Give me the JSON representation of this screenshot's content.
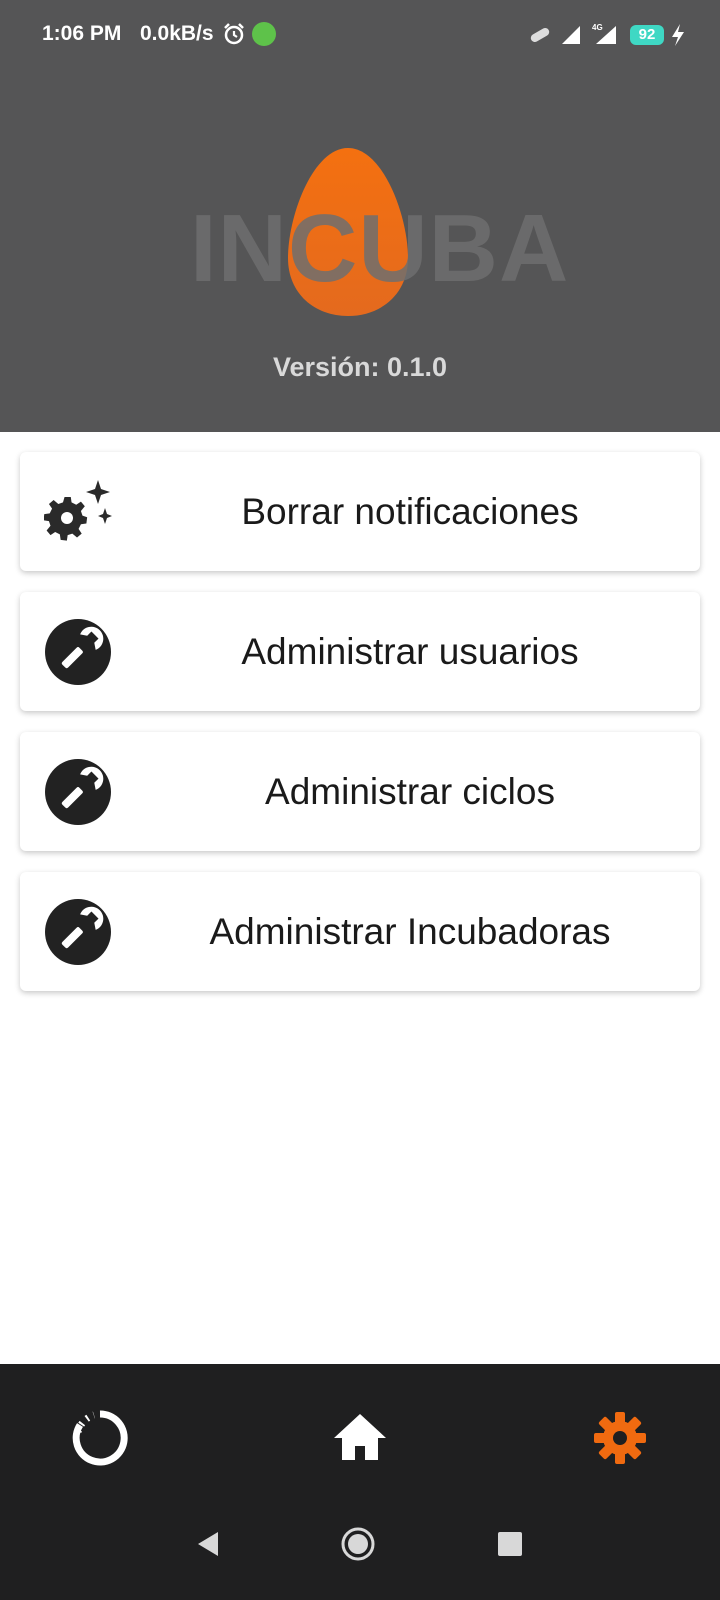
{
  "status_bar": {
    "time": "1:06 PM",
    "net_speed": "0.0kB/s",
    "battery_level": "92",
    "icons": [
      "alarm-icon",
      "app-notification-icon",
      "link-icon",
      "signal-icon",
      "signal-4g-icon",
      "battery-icon",
      "charging-icon"
    ]
  },
  "header": {
    "logo_text": "INCUBA",
    "version_label": "Versión: 0.1.0",
    "background_color": "#555556",
    "egg_color": "#f06a10"
  },
  "menu": {
    "items": [
      {
        "label": "Borrar notificaciones",
        "icon": "settings-sparkle-icon"
      },
      {
        "label": "Administrar usuarios",
        "icon": "wrench-icon"
      },
      {
        "label": "Administrar ciclos",
        "icon": "wrench-icon"
      },
      {
        "label": "Administrar Incubadoras",
        "icon": "wrench-icon"
      }
    ]
  },
  "bottom_nav": {
    "items": [
      {
        "name": "progress",
        "icon": "progress-ring-icon",
        "active": false
      },
      {
        "name": "home",
        "icon": "home-icon",
        "active": false
      },
      {
        "name": "settings",
        "icon": "gear-icon",
        "active": true
      }
    ],
    "active_color": "#f06a10",
    "inactive_color": "#ffffff"
  },
  "system_nav": {
    "icons": [
      "back-icon",
      "home-circle-icon",
      "recent-apps-icon"
    ]
  }
}
